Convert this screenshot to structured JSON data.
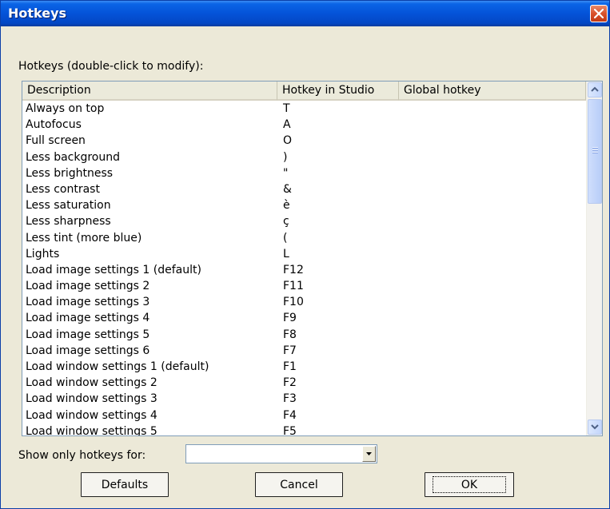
{
  "window": {
    "title": "Hotkeys"
  },
  "caption": "Hotkeys (double-click to modify):",
  "columns": {
    "description": "Description",
    "studio": "Hotkey in Studio",
    "global": "Global hotkey"
  },
  "rows": [
    {
      "description": "Always on top",
      "studio": "T",
      "global": ""
    },
    {
      "description": "Autofocus",
      "studio": "A",
      "global": ""
    },
    {
      "description": "Full screen",
      "studio": "O",
      "global": ""
    },
    {
      "description": "Less background",
      "studio": ")",
      "global": ""
    },
    {
      "description": "Less brightness",
      "studio": "\"",
      "global": ""
    },
    {
      "description": "Less contrast",
      "studio": "&",
      "global": ""
    },
    {
      "description": "Less saturation",
      "studio": "è",
      "global": ""
    },
    {
      "description": "Less sharpness",
      "studio": "ç",
      "global": ""
    },
    {
      "description": "Less tint (more blue)",
      "studio": "(",
      "global": ""
    },
    {
      "description": "Lights",
      "studio": "L",
      "global": ""
    },
    {
      "description": "Load image settings 1 (default)",
      "studio": "F12",
      "global": ""
    },
    {
      "description": "Load image settings 2",
      "studio": "F11",
      "global": ""
    },
    {
      "description": "Load image settings 3",
      "studio": "F10",
      "global": ""
    },
    {
      "description": "Load image settings 4",
      "studio": "F9",
      "global": ""
    },
    {
      "description": "Load image settings 5",
      "studio": "F8",
      "global": ""
    },
    {
      "description": "Load image settings 6",
      "studio": "F7",
      "global": ""
    },
    {
      "description": "Load window settings 1 (default)",
      "studio": "F1",
      "global": ""
    },
    {
      "description": "Load window settings 2",
      "studio": "F2",
      "global": ""
    },
    {
      "description": "Load window settings 3",
      "studio": "F3",
      "global": ""
    },
    {
      "description": "Load window settings 4",
      "studio": "F4",
      "global": ""
    },
    {
      "description": "Load window settings 5",
      "studio": "F5",
      "global": ""
    }
  ],
  "filter": {
    "label": "Show only hotkeys for:",
    "value": ""
  },
  "buttons": {
    "defaults": "Defaults",
    "cancel": "Cancel",
    "ok": "OK"
  },
  "icons": {
    "close": "close-icon",
    "scroll_up": "chevron-up-icon",
    "scroll_down": "chevron-down-icon",
    "dropdown": "caret-down-icon"
  },
  "colors": {
    "titlebar": "#0453d8",
    "dialog_bg": "#ece9d8",
    "close": "#d9512b",
    "list_border": "#7f9db9"
  }
}
